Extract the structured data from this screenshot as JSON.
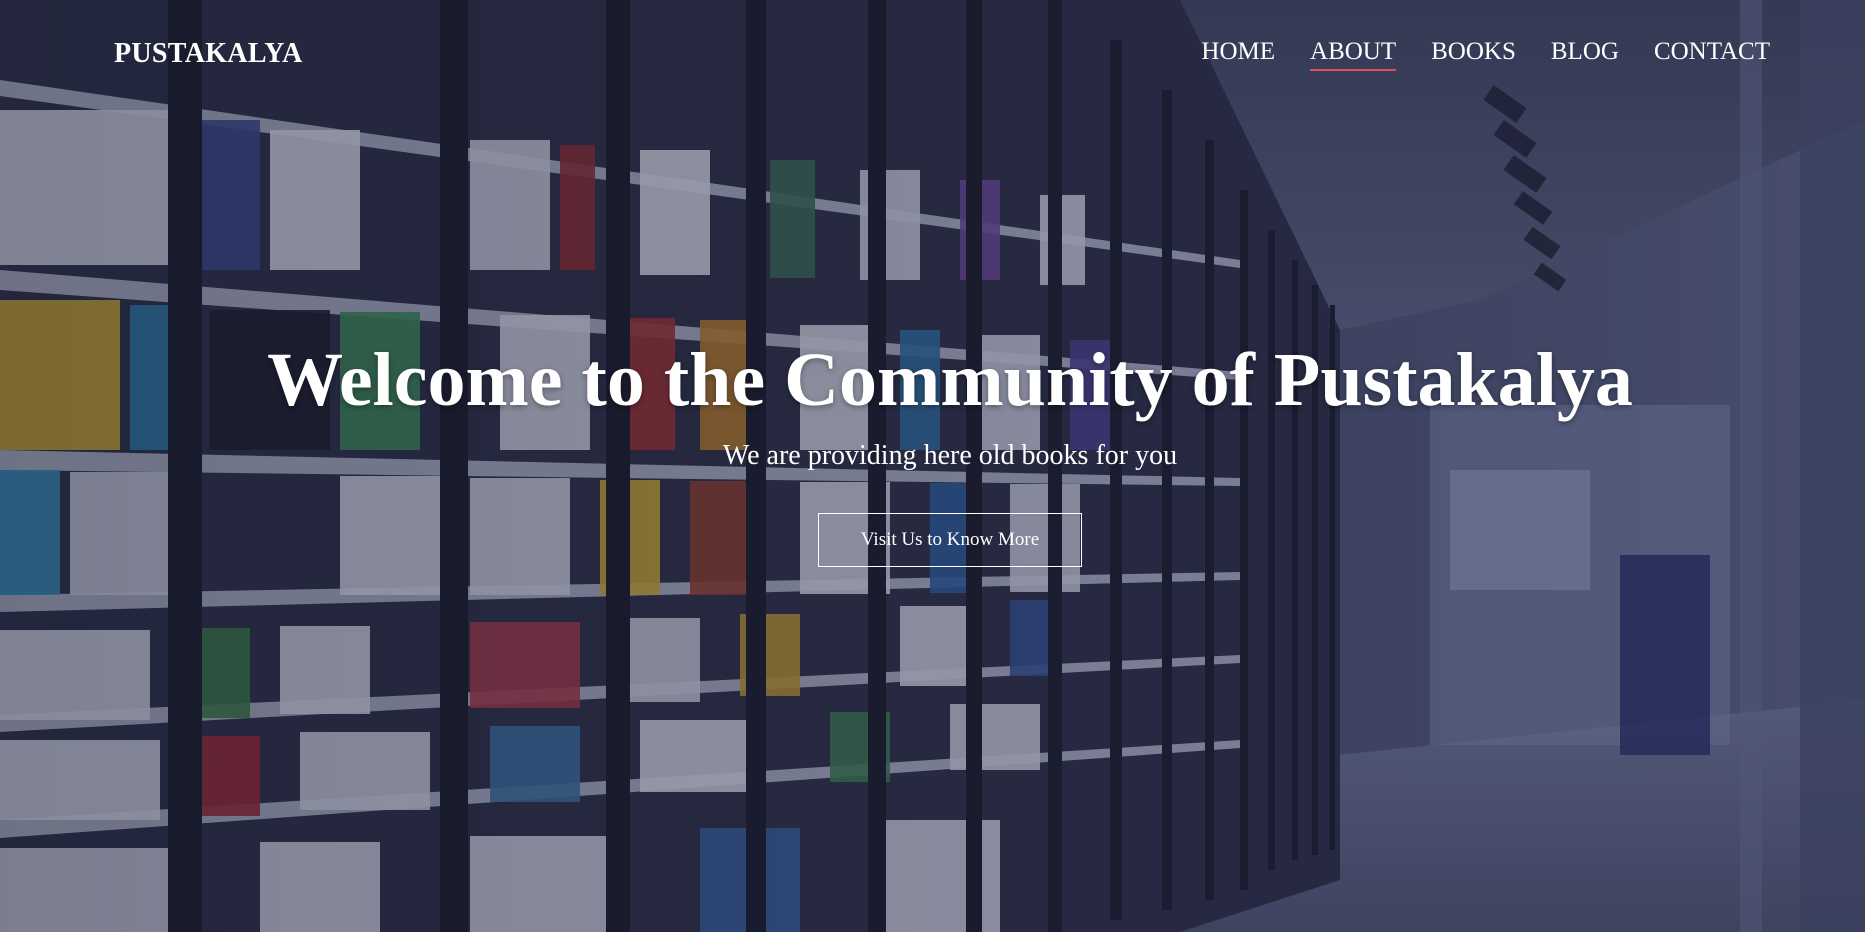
{
  "brand": "PUSTAKALYA",
  "nav": {
    "items": [
      {
        "label": "HOME"
      },
      {
        "label": "ABOUT",
        "active": true
      },
      {
        "label": "BOOKS"
      },
      {
        "label": "BLOG"
      },
      {
        "label": "CONTACT"
      }
    ],
    "active_underline_color": "#e24b5a"
  },
  "hero": {
    "title": "Welcome to the Community of Pustakalya",
    "subtitle": "We are providing here old books for you",
    "cta_label": "Visit Us to Know More",
    "background": "library-bookshelves-photo"
  },
  "colors": {
    "text": "#ffffff",
    "overlay": "#1c1e37",
    "accent": "#e24b5a"
  }
}
